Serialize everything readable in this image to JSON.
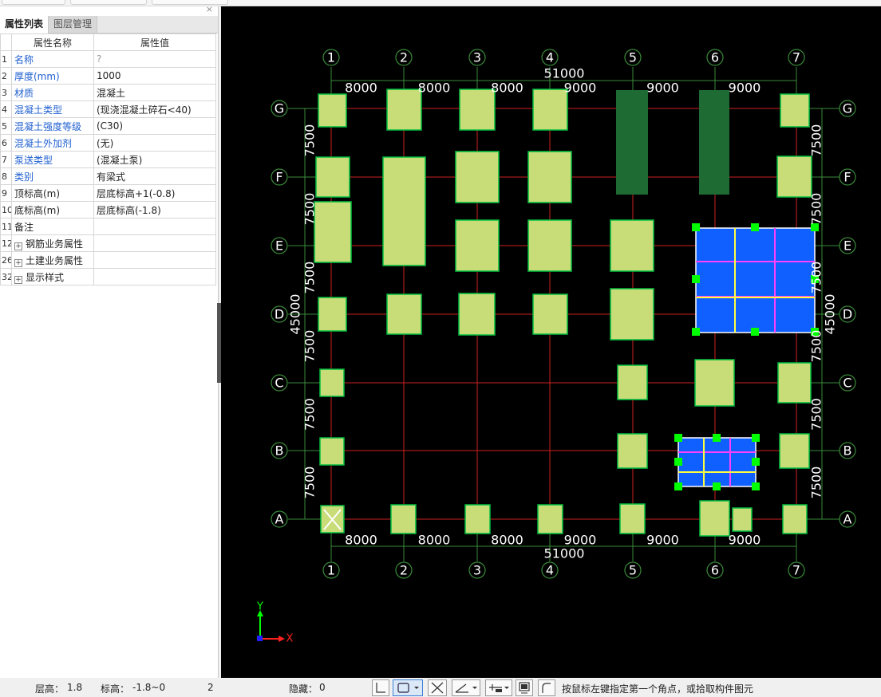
{
  "panel": {
    "close_icon": "×",
    "tabs": [
      "属性列表",
      "图层管理"
    ],
    "header": {
      "name": "属性名称",
      "value": "属性值"
    },
    "rows": [
      {
        "idx": "1",
        "name": "名称",
        "value": "?",
        "name_color": "blue",
        "value_color": "grey"
      },
      {
        "idx": "2",
        "name": "厚度(mm)",
        "value": "1000",
        "name_color": "blue",
        "value_color": "black"
      },
      {
        "idx": "3",
        "name": "材质",
        "value": "混凝土",
        "name_color": "blue",
        "value_color": "black"
      },
      {
        "idx": "4",
        "name": "混凝土类型",
        "value": "(现浇混凝土碎石<40)",
        "name_color": "blue",
        "value_color": "black"
      },
      {
        "idx": "5",
        "name": "混凝土强度等级",
        "value": "(C30)",
        "name_color": "blue",
        "value_color": "black"
      },
      {
        "idx": "6",
        "name": "混凝土外加剂",
        "value": "(无)",
        "name_color": "blue",
        "value_color": "black"
      },
      {
        "idx": "7",
        "name": "泵送类型",
        "value": "(混凝土泵)",
        "name_color": "blue",
        "value_color": "black"
      },
      {
        "idx": "8",
        "name": "类别",
        "value": "有梁式",
        "name_color": "blue",
        "value_color": "black"
      },
      {
        "idx": "9",
        "name": "顶标高(m)",
        "value": "层底标高+1(-0.8)",
        "name_color": "black",
        "value_color": "black"
      },
      {
        "idx": "10",
        "name": "底标高(m)",
        "value": "层底标高(-1.8)",
        "name_color": "black",
        "value_color": "black"
      },
      {
        "idx": "11",
        "name": "备注",
        "value": "",
        "name_color": "black",
        "value_color": "black"
      },
      {
        "idx": "12",
        "name": "钢筋业务属性",
        "value": "",
        "name_color": "black",
        "value_color": "black",
        "expandable": true
      },
      {
        "idx": "26",
        "name": "土建业务属性",
        "value": "",
        "name_color": "black",
        "value_color": "black",
        "expandable": true
      },
      {
        "idx": "32",
        "name": "显示样式",
        "value": "",
        "name_color": "black",
        "value_color": "black",
        "expandable": true
      }
    ]
  },
  "drawing": {
    "col_labels": [
      "1",
      "2",
      "3",
      "4",
      "5",
      "6",
      "7"
    ],
    "row_labels": [
      "G",
      "F",
      "E",
      "D",
      "C",
      "B",
      "A"
    ],
    "col_spacings": [
      "8000",
      "8000",
      "8000",
      "9000",
      "9000",
      "9000"
    ],
    "row_spacings": [
      "7500",
      "7500",
      "7500",
      "7500",
      "7500",
      "7500"
    ],
    "total_x": "51000",
    "total_y": "45000",
    "axis_x": "X",
    "axis_y": "Y",
    "colors": {
      "background": "#000000",
      "axis_line": "#cc1f1f",
      "dim_line": "#3a8a3a",
      "footing_fill": "#c8dc78",
      "footing_stroke": "#00c040",
      "dark_footing": "#1e6b33",
      "raft_fill": "#1060ff",
      "grip": "#00ff00",
      "rebar_yellow": "#ffff40",
      "rebar_magenta": "#ff40ff"
    }
  },
  "status": {
    "floor_height_label": "层高：",
    "floor_height": "1.8",
    "elev_label": "标高：",
    "elev": "-1.8~0",
    "count": "2",
    "hidden_label": "隐藏：",
    "hidden": "0",
    "prompt": "按鼠标左键指定第一个角点，或拾取构件图元"
  }
}
